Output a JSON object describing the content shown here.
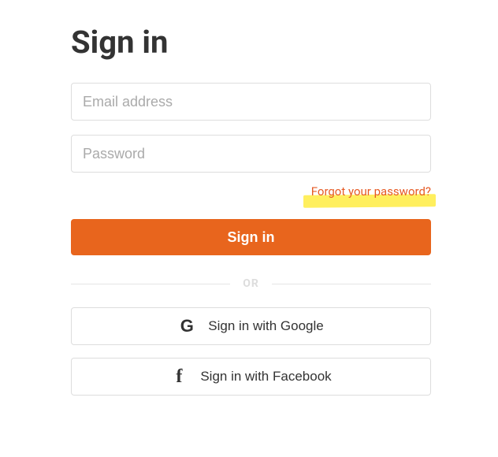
{
  "heading": "Sign in",
  "fields": {
    "email_placeholder": "Email address",
    "password_placeholder": "Password"
  },
  "forgot_link": "Forgot your password?",
  "submit_label": "Sign in",
  "divider_text": "OR",
  "social": {
    "google_label": "Sign in with Google",
    "google_icon": "G",
    "facebook_label": "Sign in with Facebook",
    "facebook_icon": "f"
  },
  "colors": {
    "accent": "#e8651d",
    "highlight": "#ffef5e"
  }
}
